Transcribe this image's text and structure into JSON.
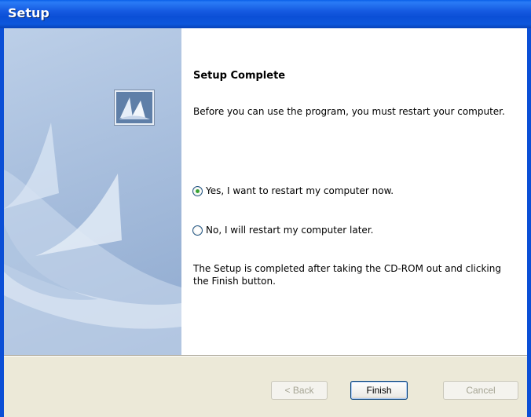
{
  "window": {
    "title": "Setup"
  },
  "main": {
    "heading": "Setup Complete",
    "intro": "Before you can use the program, you must restart your computer.",
    "options": [
      {
        "label": "Yes, I want to restart my computer now.",
        "selected": true
      },
      {
        "label": "No, I will restart my computer later.",
        "selected": false
      }
    ],
    "footer_text": "The Setup is completed after taking the CD-ROM out and clicking the Finish button."
  },
  "buttons": {
    "back": "< Back",
    "finish": "Finish",
    "cancel": "Cancel"
  },
  "icons": {
    "logo": "setup-logo-icon"
  },
  "colors": {
    "titlebar": "#0b4fd6",
    "radio_selected": "#3aa334",
    "dialog_bg": "#ece9d8"
  }
}
